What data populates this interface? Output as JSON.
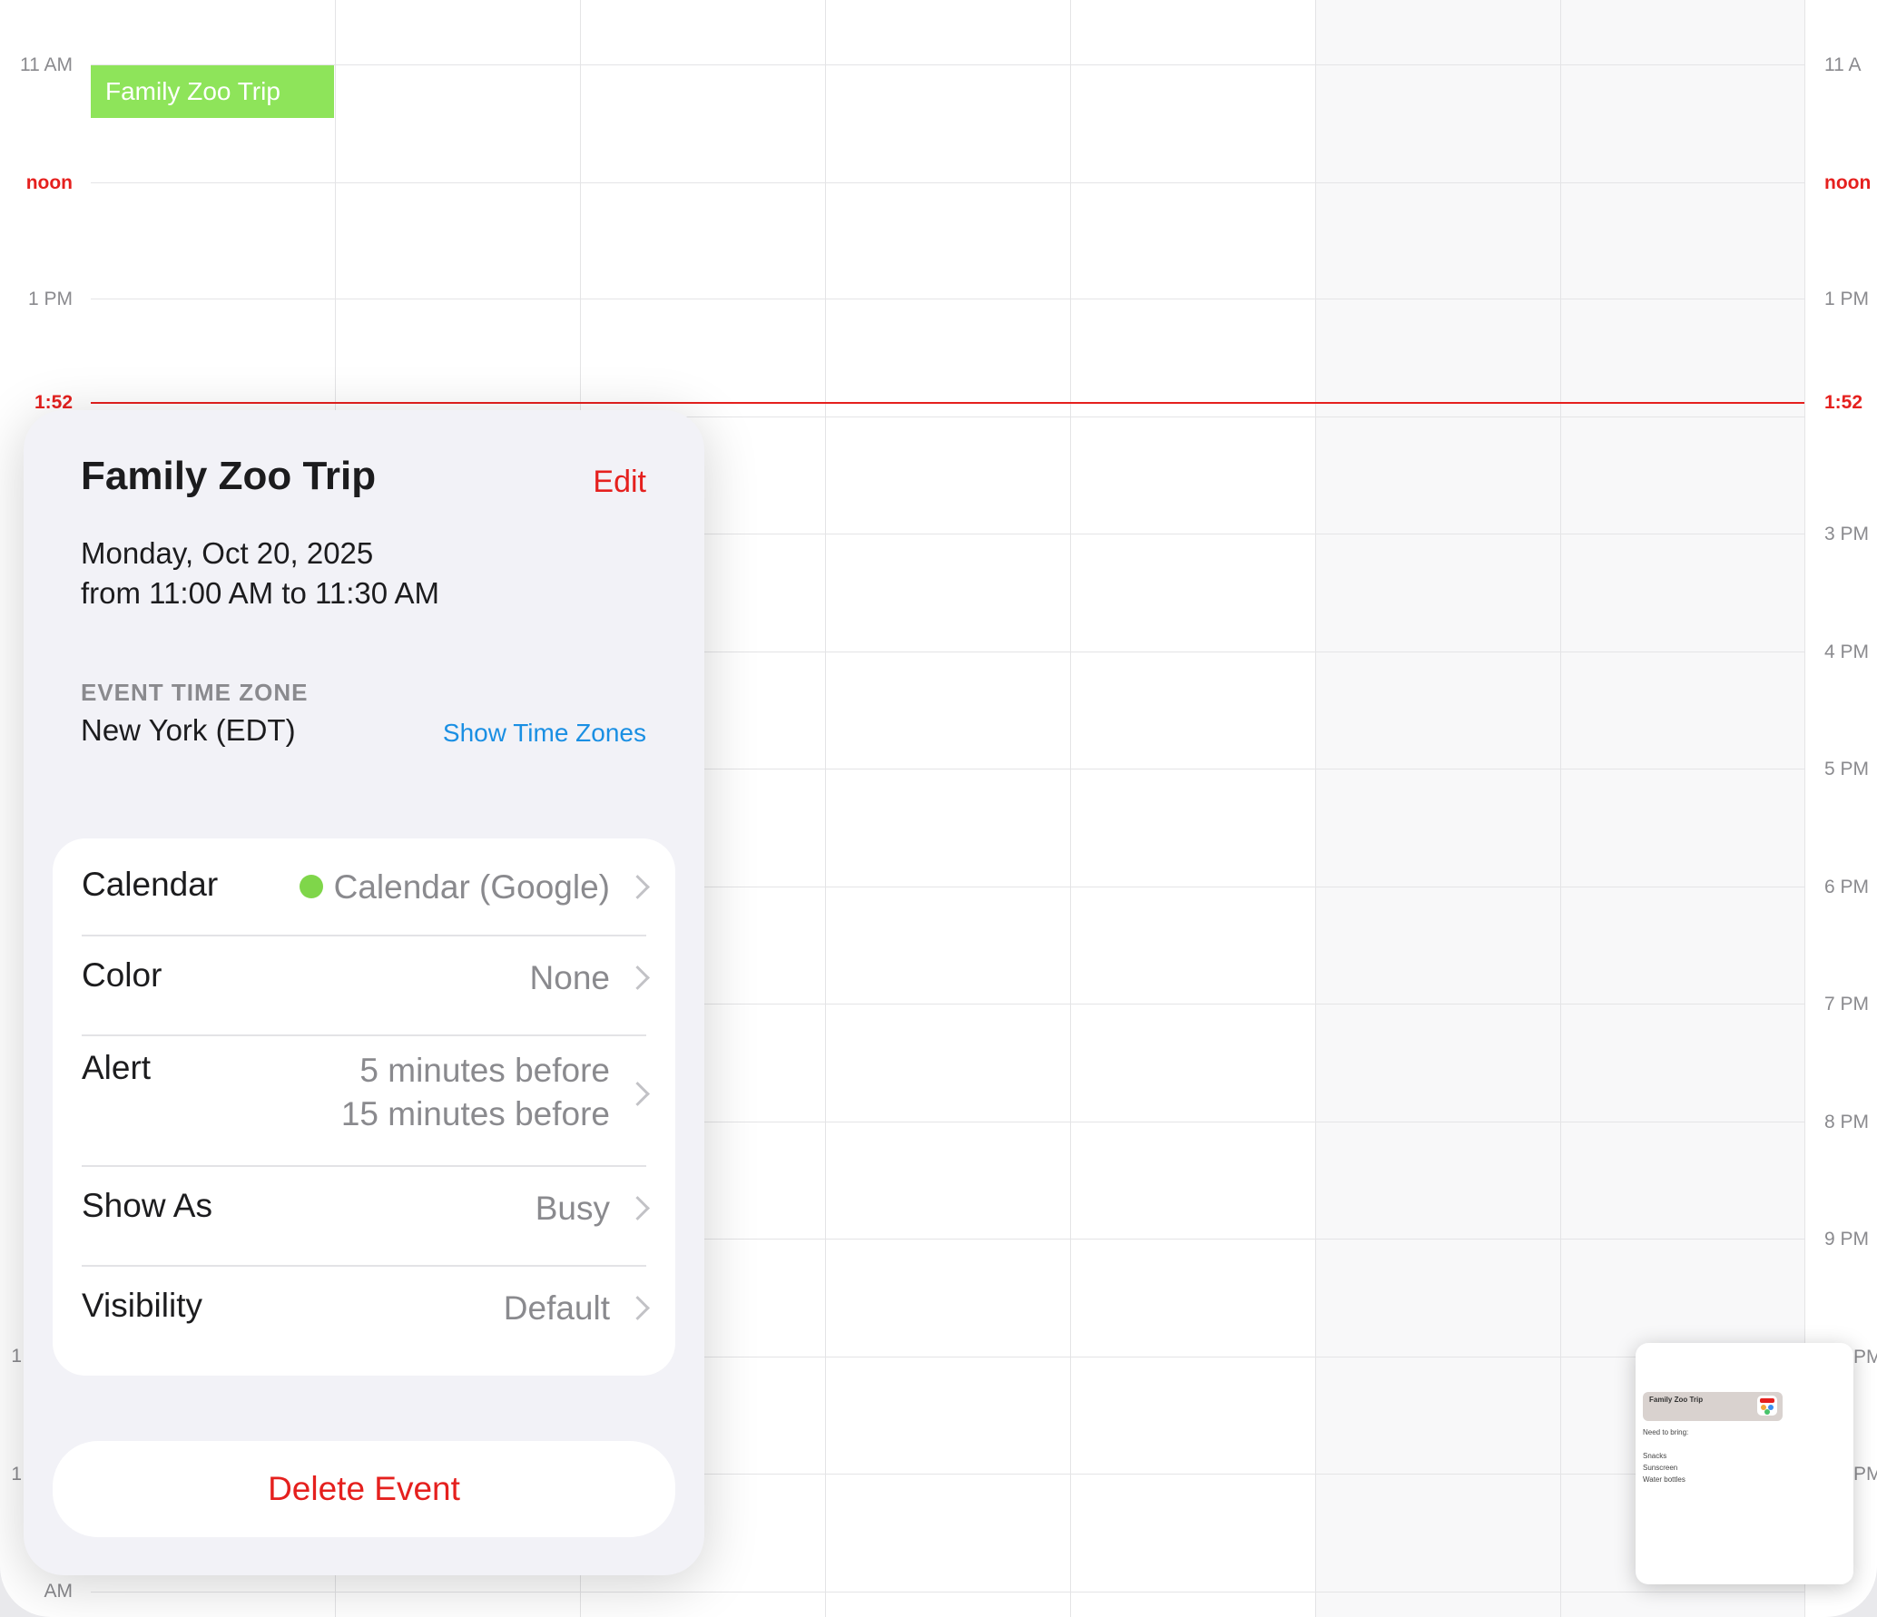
{
  "calendar_grid": {
    "hour_labels_left": [
      "11 AM",
      "noon",
      "1 PM",
      "1",
      "1",
      "AM"
    ],
    "hour_labels_right": [
      "11 A",
      "noon",
      "1 PM",
      "3 PM",
      "4 PM",
      "5 PM",
      "6 PM",
      "7 PM",
      "8 PM",
      "9 PM",
      "PM",
      "PM"
    ],
    "current_time": "1:52",
    "event_block_title": "Family Zoo Trip",
    "event_color": "#8ee45a",
    "now_color": "#e5201e"
  },
  "event": {
    "title": "Family Zoo Trip",
    "edit_label": "Edit",
    "date_line": "Monday, Oct 20, 2025",
    "time_line": "from 11:00 AM to 11:30 AM",
    "tz_heading": "EVENT TIME ZONE",
    "tz_value": "New York (EDT)",
    "tz_link": "Show Time Zones",
    "details": {
      "calendar_label": "Calendar",
      "calendar_value": "Calendar (Google)",
      "calendar_dot_color": "#7fd64a",
      "color_label": "Color",
      "color_value": "None",
      "alert_label": "Alert",
      "alert_value_1": "5 minutes before",
      "alert_value_2": "15 minutes before",
      "showas_label": "Show As",
      "showas_value": "Busy",
      "visibility_label": "Visibility",
      "visibility_value": "Default"
    },
    "delete_label": "Delete Event"
  },
  "thumbnail": {
    "title": "Family Zoo Trip",
    "heading": "Need to bring:",
    "items": [
      "Snacks",
      "Sunscreen",
      "Water bottles"
    ]
  }
}
